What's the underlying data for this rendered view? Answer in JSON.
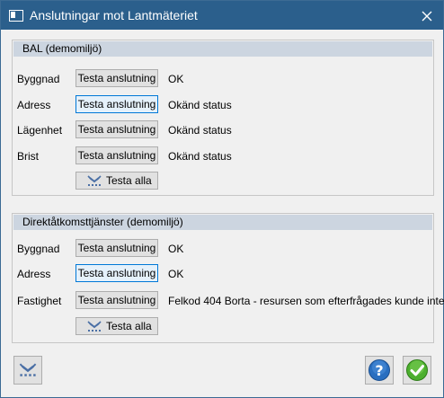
{
  "window": {
    "title": "Anslutningar mot Lantmäteriet"
  },
  "icons": {
    "app": "window-icon",
    "close": "close-icon",
    "connect": "connection-icon",
    "help": "help-icon",
    "ok": "checkmark-icon"
  },
  "colors": {
    "titlebar": "#2b5f8c",
    "group_header": "#ccd5e0",
    "focus_border": "#0078d7",
    "help": "#2a6fc0",
    "ok": "#4caf2e"
  },
  "bal": {
    "header": "BAL (demomiljö)",
    "rows": [
      {
        "label": "Byggnad",
        "button": "Testa anslutning",
        "status": "OK"
      },
      {
        "label": "Adress",
        "button": "Testa anslutning",
        "status": "Okänd status"
      },
      {
        "label": "Lägenhet",
        "button": "Testa anslutning",
        "status": "Okänd status"
      },
      {
        "label": "Brist",
        "button": "Testa anslutning",
        "status": "Okänd status"
      }
    ],
    "test_all": "Testa alla"
  },
  "direkt": {
    "header": "Direktåtkomsttjänster (demomiljö)",
    "rows": [
      {
        "label": "Byggnad",
        "button": "Testa anslutning",
        "status": "OK"
      },
      {
        "label": "Adress",
        "button": "Testa anslutning",
        "status": "OK"
      },
      {
        "label": "Fastighet",
        "button": "Testa anslutning",
        "status": "Felkod 404 Borta - resursen som efterfrågades kunde inte"
      }
    ],
    "test_all": "Testa alla"
  }
}
